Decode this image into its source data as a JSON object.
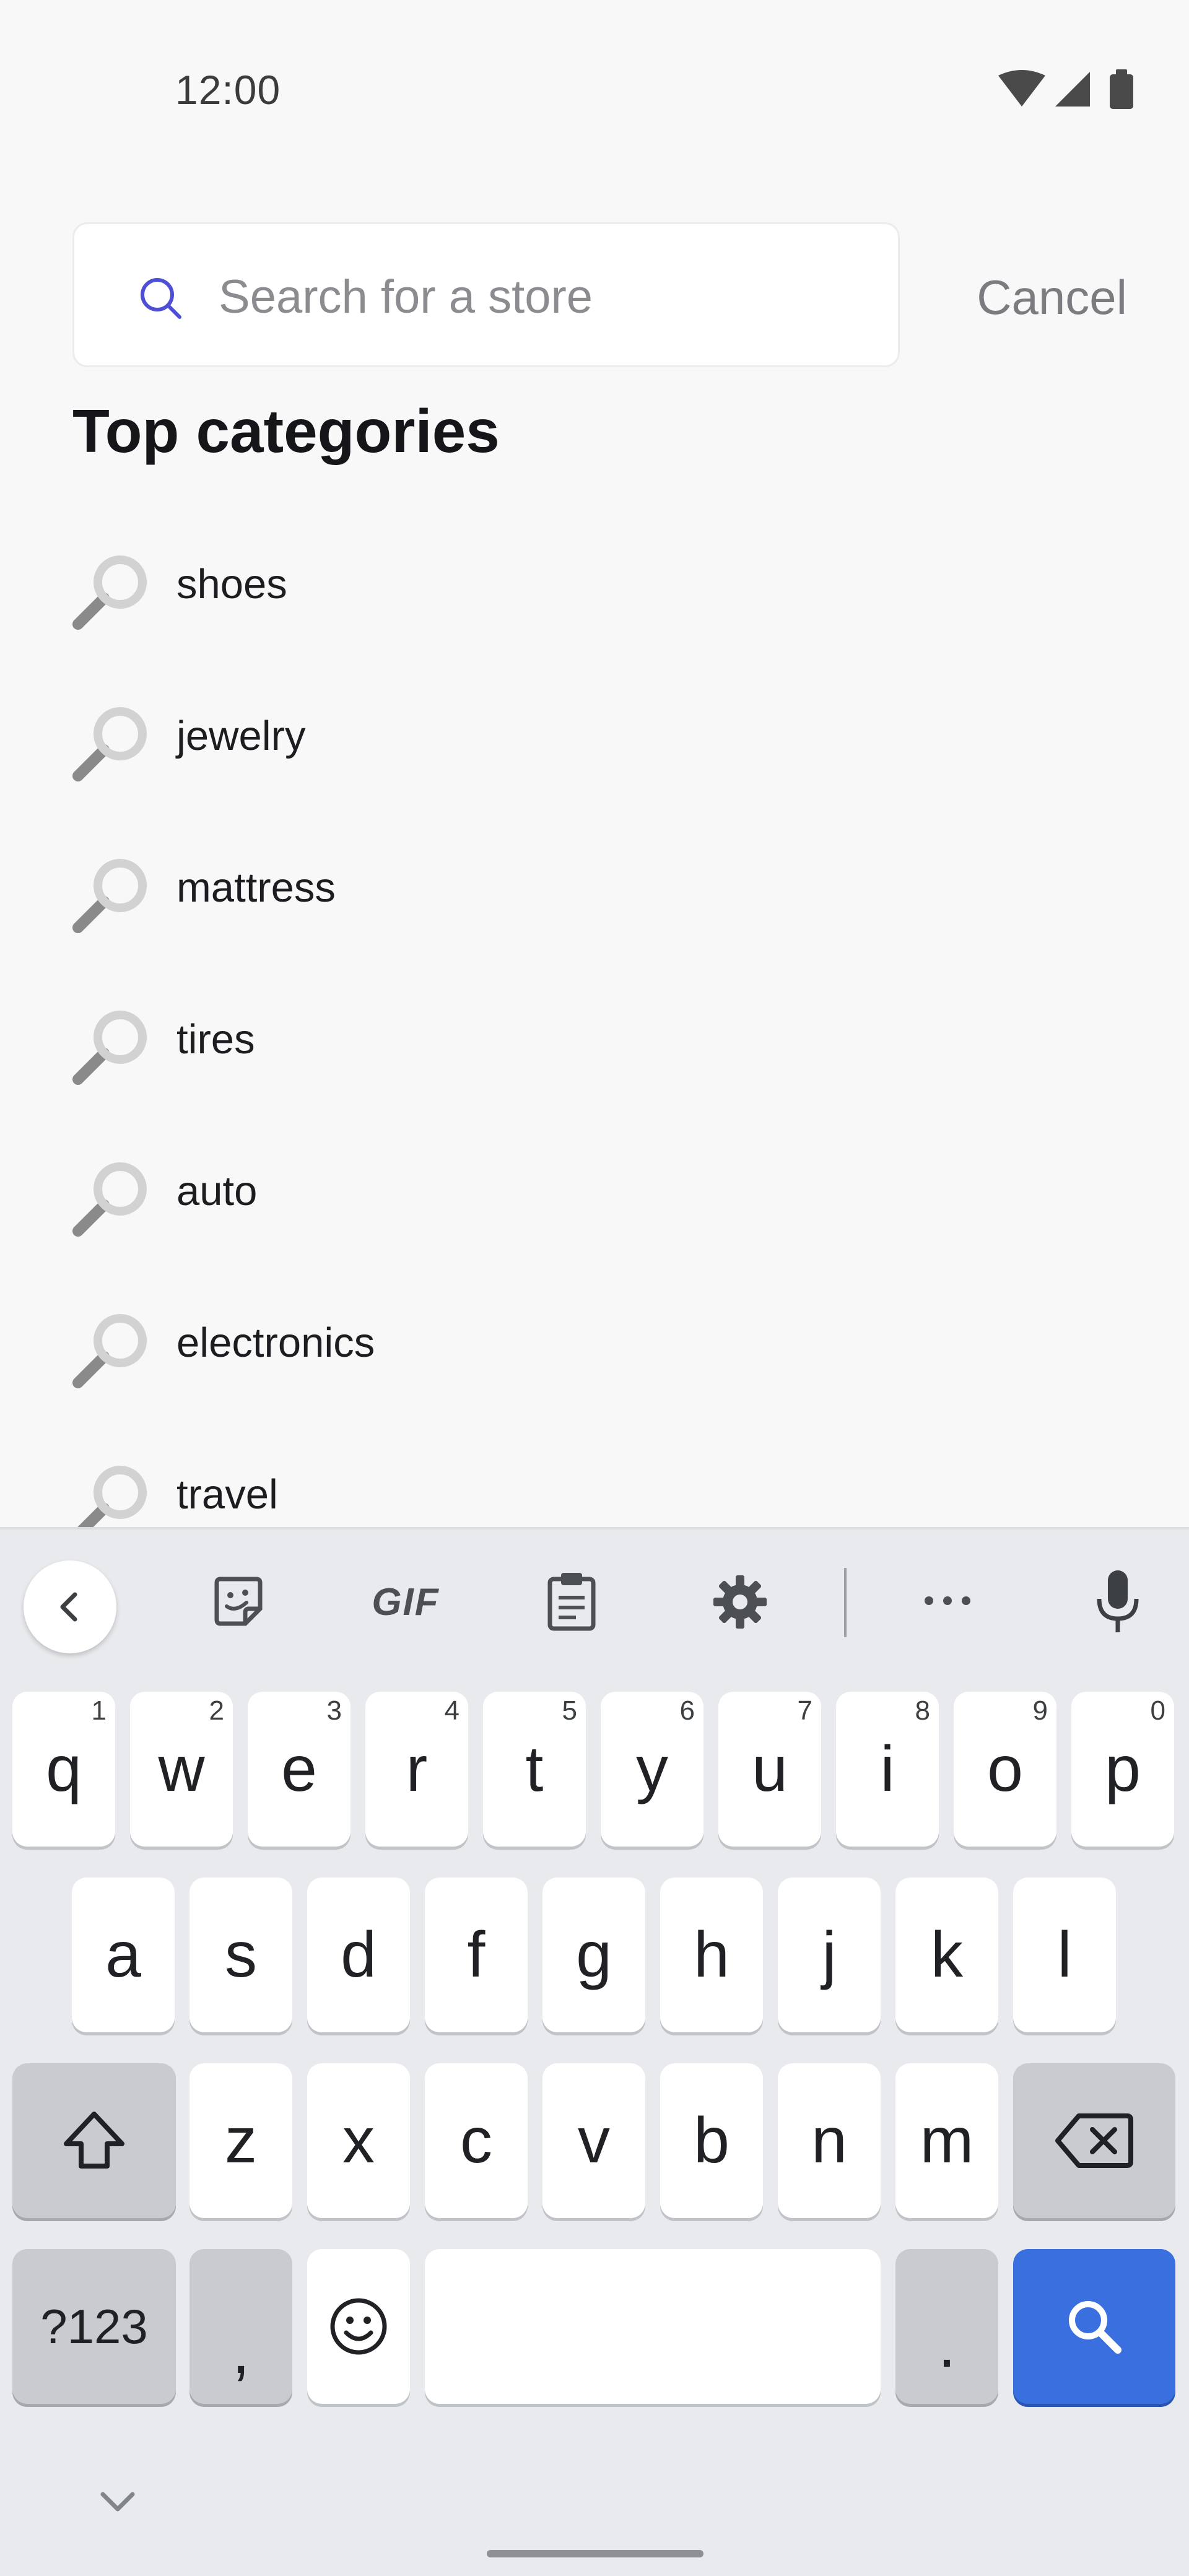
{
  "status_bar": {
    "time": "12:00"
  },
  "search": {
    "placeholder": "Search for a store",
    "value": "",
    "cancel_label": "Cancel",
    "accent": "#4f4fd6"
  },
  "section_title": "Top categories",
  "categories": [
    {
      "label": "shoes"
    },
    {
      "label": "jewelry"
    },
    {
      "label": "mattress"
    },
    {
      "label": "tires"
    },
    {
      "label": "auto"
    },
    {
      "label": "electronics"
    },
    {
      "label": "travel"
    }
  ],
  "keyboard": {
    "toolbar": {
      "gif_label": "GIF",
      "icons": [
        "back-icon",
        "sticker-icon",
        "gif-icon",
        "clipboard-icon",
        "settings-icon",
        "more-icon",
        "microphone-icon"
      ]
    },
    "row1": [
      {
        "key": "q",
        "hint": "1"
      },
      {
        "key": "w",
        "hint": "2"
      },
      {
        "key": "e",
        "hint": "3"
      },
      {
        "key": "r",
        "hint": "4"
      },
      {
        "key": "t",
        "hint": "5"
      },
      {
        "key": "y",
        "hint": "6"
      },
      {
        "key": "u",
        "hint": "7"
      },
      {
        "key": "i",
        "hint": "8"
      },
      {
        "key": "o",
        "hint": "9"
      },
      {
        "key": "p",
        "hint": "0"
      }
    ],
    "row2": [
      "a",
      "s",
      "d",
      "f",
      "g",
      "h",
      "j",
      "k",
      "l"
    ],
    "row3": [
      "z",
      "x",
      "c",
      "v",
      "b",
      "n",
      "m"
    ],
    "symbols_label": "?123",
    "comma_label": ",",
    "period_label": ".",
    "action_color": "#3a6fe0"
  }
}
